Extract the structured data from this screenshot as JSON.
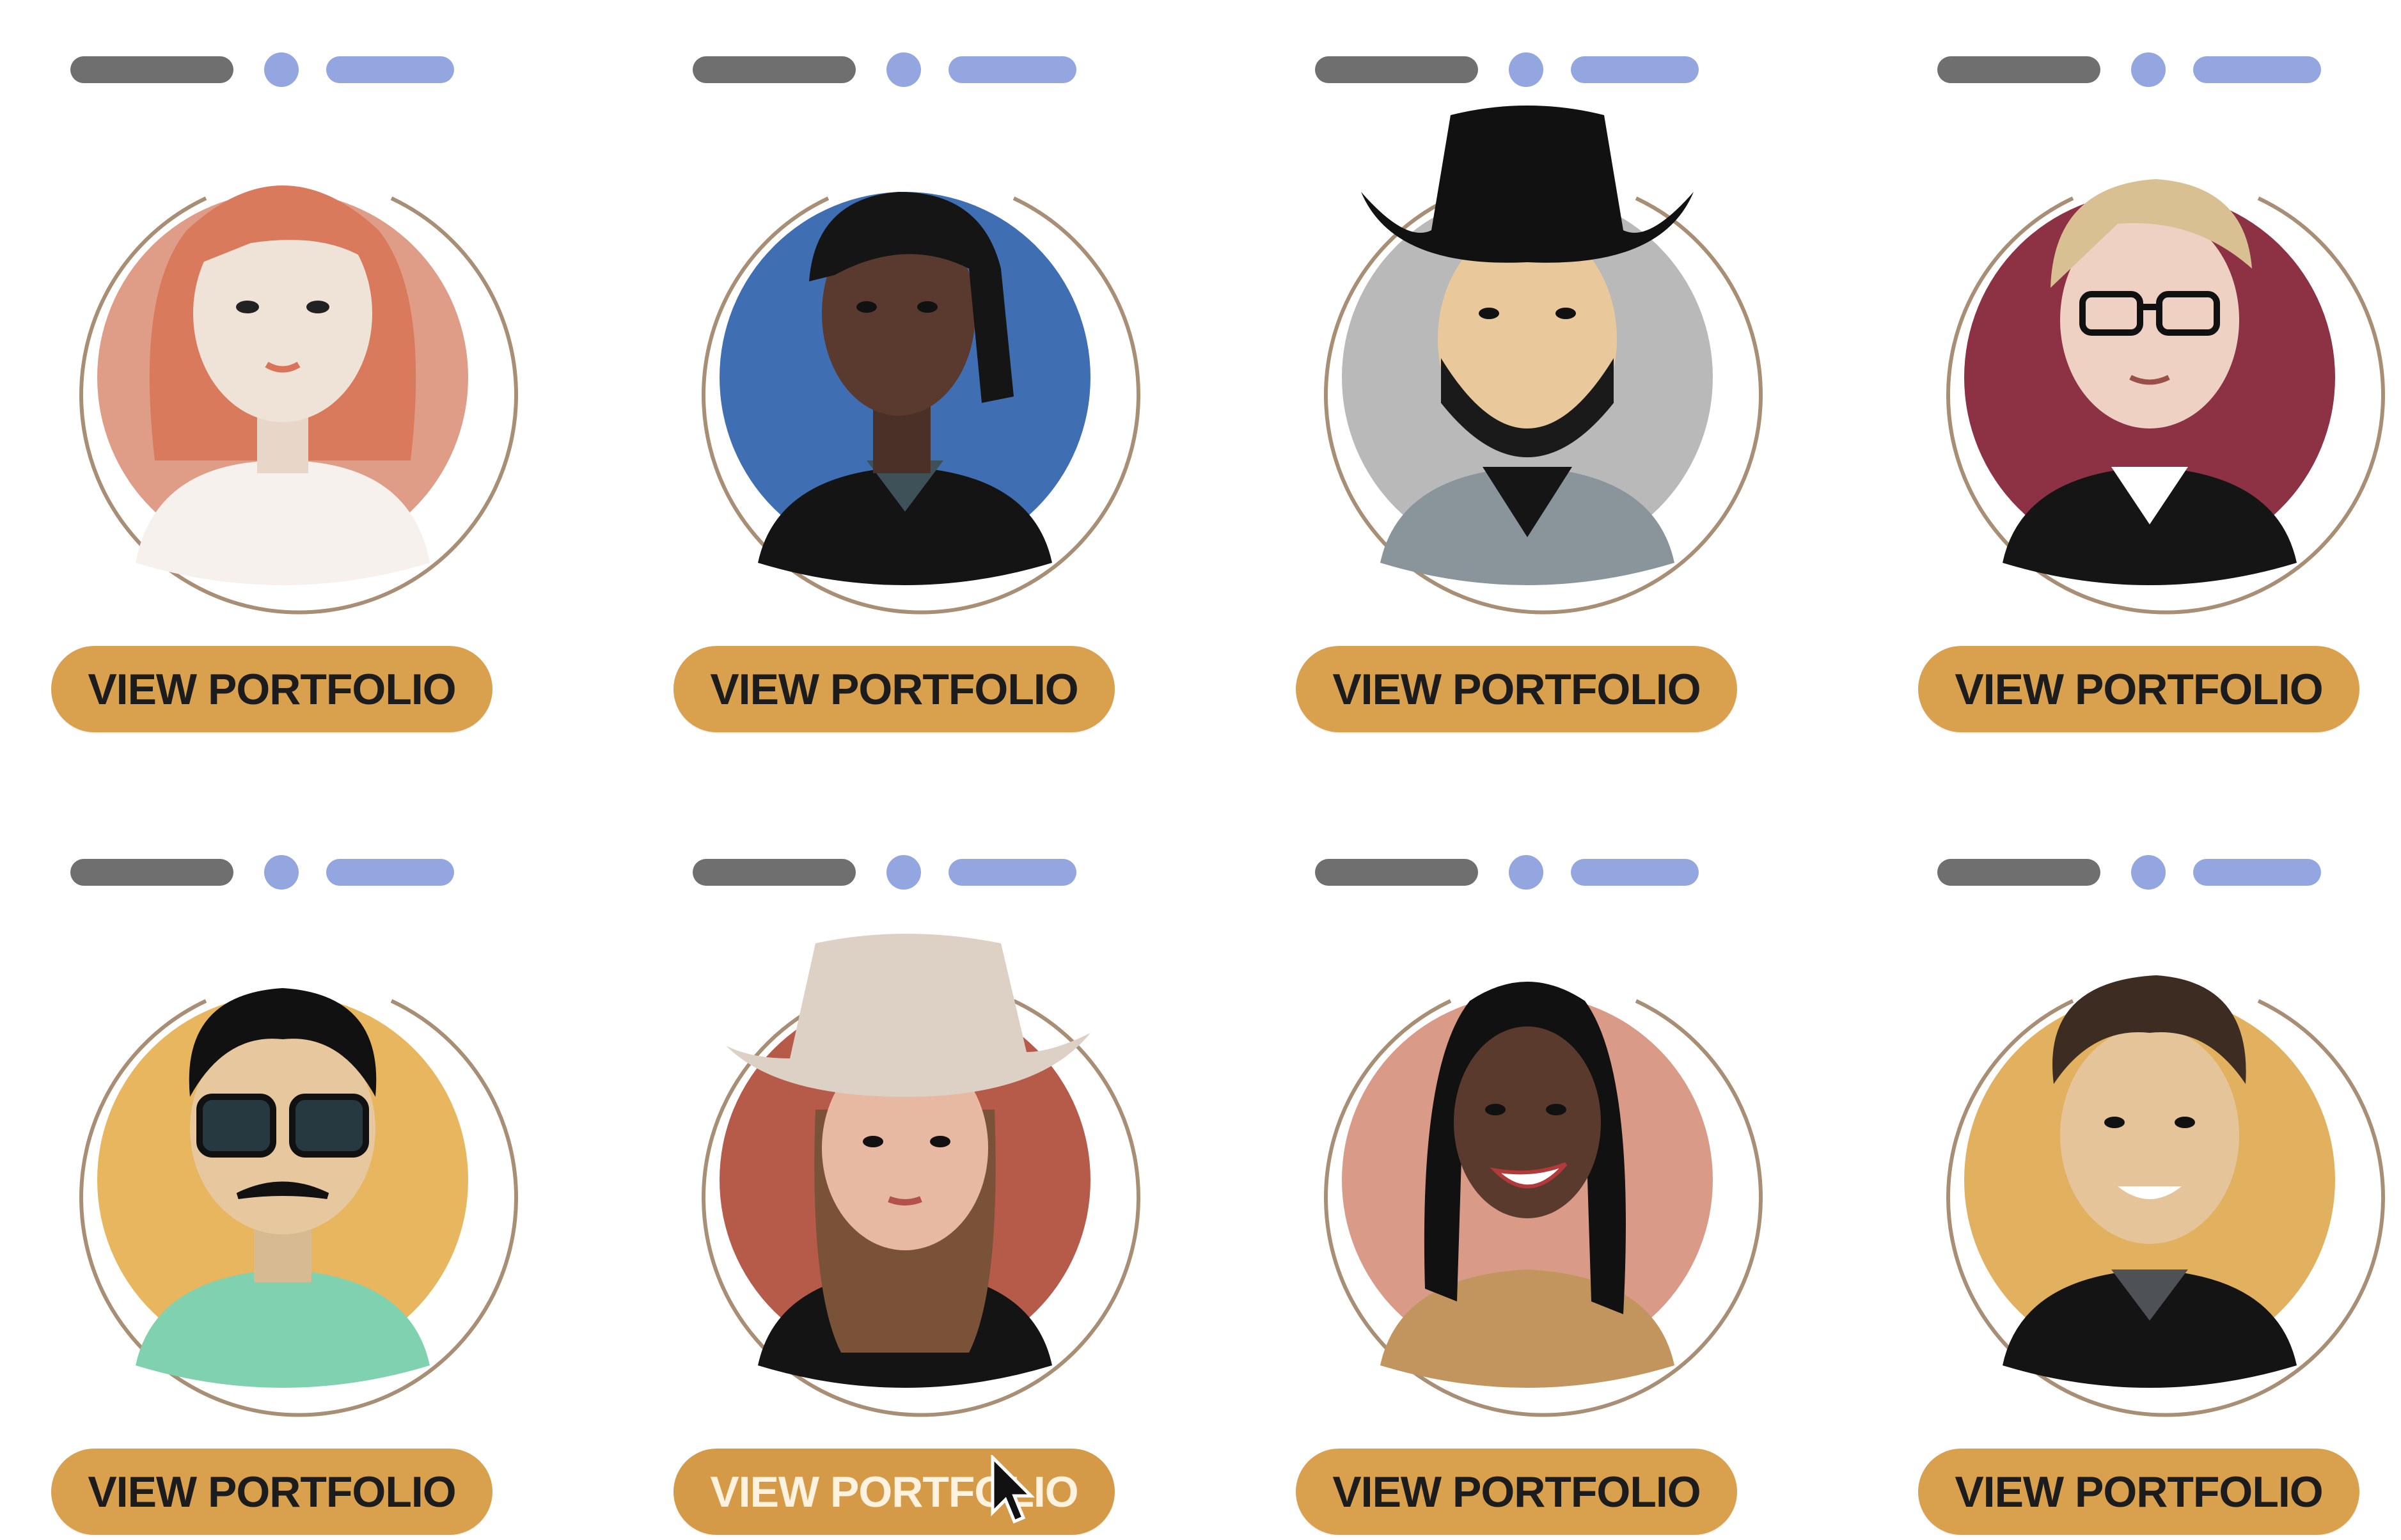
{
  "grid": {
    "cards": [
      {
        "button_label": "VIEW PORTFOLIO",
        "avatar": "avatar-red-hair-woman"
      },
      {
        "button_label": "VIEW PORTFOLIO",
        "avatar": "avatar-dreadlocks-man"
      },
      {
        "button_label": "VIEW PORTFOLIO",
        "avatar": "avatar-cowboy-hat-man"
      },
      {
        "button_label": "VIEW PORTFOLIO",
        "avatar": "avatar-glasses-blonde"
      },
      {
        "button_label": "VIEW PORTFOLIO",
        "avatar": "avatar-sunglasses-man"
      },
      {
        "button_label": "VIEW PORTFOLIO",
        "avatar": "avatar-cowgirl"
      },
      {
        "button_label": "VIEW PORTFOLIO",
        "avatar": "avatar-smiling-woman"
      },
      {
        "button_label": "VIEW PORTFOLIO",
        "avatar": "avatar-smiling-man"
      }
    ]
  },
  "colors": {
    "button": "#d9a04e",
    "indicator_gray": "#6f6f6f",
    "indicator_blue": "#93a6df",
    "ring": "#a78e74"
  }
}
